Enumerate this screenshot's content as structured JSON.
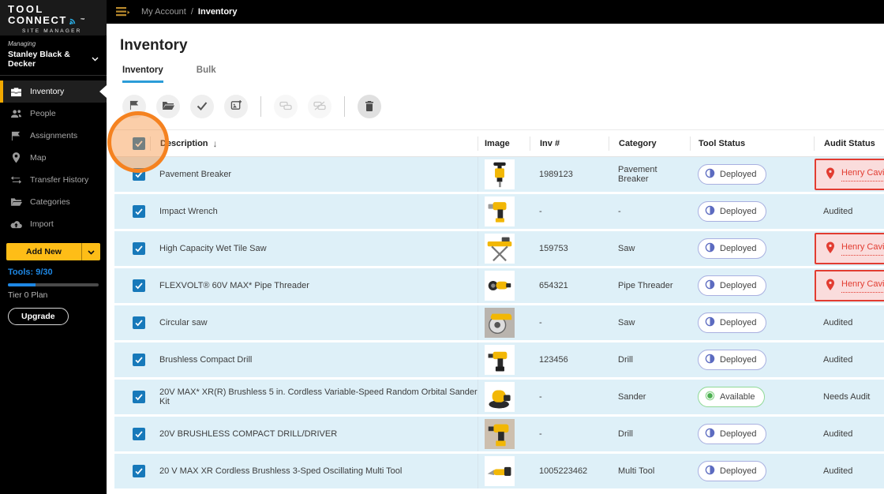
{
  "logo": {
    "line1": "TOOL",
    "line2": "CONNECT",
    "tm": "™",
    "sub": "SITE MANAGER"
  },
  "topbar": {
    "breadcrumb_parent": "My Account",
    "breadcrumb_separator": "/",
    "breadcrumb_current": "Inventory"
  },
  "sidebar": {
    "managing_label": "Managing",
    "managing_value": "Stanley Black & Decker",
    "items": [
      {
        "slug": "inventory",
        "label": "Inventory",
        "icon": "toolbox-icon",
        "active": true
      },
      {
        "slug": "people",
        "label": "People",
        "icon": "people-icon",
        "active": false
      },
      {
        "slug": "assignments",
        "label": "Assignments",
        "icon": "flag-icon",
        "active": false
      },
      {
        "slug": "map",
        "label": "Map",
        "icon": "map-pin-icon",
        "active": false
      },
      {
        "slug": "transfer-history",
        "label": "Transfer History",
        "icon": "transfer-arrows-icon",
        "active": false
      },
      {
        "slug": "categories",
        "label": "Categories",
        "icon": "folder-icon",
        "active": false
      },
      {
        "slug": "import",
        "label": "Import",
        "icon": "cloud-upload-icon",
        "active": false
      }
    ],
    "add_new_label": "Add New",
    "tools_text": "Tools: 9/30",
    "tools_used": 9,
    "tools_total": 30,
    "plan_label": "Tier 0 Plan",
    "upgrade_label": "Upgrade"
  },
  "main": {
    "title": "Inventory",
    "tabs": [
      {
        "label": "Inventory",
        "active": true
      },
      {
        "label": "Bulk",
        "active": false
      }
    ],
    "toolbar": [
      {
        "name": "flag",
        "enabled": true
      },
      {
        "name": "folder",
        "enabled": true
      },
      {
        "name": "approve",
        "enabled": true
      },
      {
        "name": "add-image",
        "enabled": true
      },
      {
        "type": "divider"
      },
      {
        "name": "transfer",
        "enabled": false
      },
      {
        "name": "transfer-cancel",
        "enabled": false
      },
      {
        "type": "divider"
      },
      {
        "name": "delete",
        "enabled": true,
        "dark": true
      }
    ]
  },
  "table": {
    "columns": [
      "Description",
      "Image",
      "Inv #",
      "Category",
      "Tool Status",
      "Audit Status"
    ],
    "sort_column": "Description",
    "sort_direction": "↓",
    "select_all_checked": true,
    "rows": [
      {
        "description": "Pavement Breaker",
        "thumb": "breaker",
        "inv": "1989123",
        "category": "Pavement Breaker",
        "tool_status": "Deployed",
        "audit_status": "Henry Cavill",
        "audit_type": "flagged",
        "checked": true
      },
      {
        "description": "Impact Wrench",
        "thumb": "impact-wrench",
        "inv": "-",
        "category": "-",
        "tool_status": "Deployed",
        "audit_status": "Audited",
        "audit_type": "plain",
        "checked": true
      },
      {
        "description": "High Capacity Wet Tile Saw",
        "thumb": "tile-saw",
        "inv": "159753",
        "category": "Saw",
        "tool_status": "Deployed",
        "audit_status": "Henry Cavill",
        "audit_type": "flagged",
        "checked": true
      },
      {
        "description": "FLEXVOLT® 60V MAX* Pipe Threader",
        "thumb": "pipe-threader",
        "inv": "654321",
        "category": "Pipe Threader",
        "tool_status": "Deployed",
        "audit_status": "Henry Cavill",
        "audit_type": "flagged",
        "checked": true
      },
      {
        "description": "Circular saw",
        "thumb": "circular-saw",
        "inv": "-",
        "category": "Saw",
        "tool_status": "Deployed",
        "audit_status": "Audited",
        "audit_type": "plain",
        "checked": true
      },
      {
        "description": "Brushless Compact Drill",
        "thumb": "drill",
        "inv": "123456",
        "category": "Drill",
        "tool_status": "Deployed",
        "audit_status": "Audited",
        "audit_type": "plain",
        "checked": true
      },
      {
        "description": "20V MAX* XR(R) Brushless 5 in. Cordless Variable-Speed Random Orbital Sander Kit",
        "thumb": "sander",
        "inv": "-",
        "category": "Sander",
        "tool_status": "Available",
        "audit_status": "Needs Audit",
        "audit_type": "plain",
        "checked": true
      },
      {
        "description": "20V BRUSHLESS COMPACT DRILL/DRIVER",
        "thumb": "drill2",
        "inv": "-",
        "category": "Drill",
        "tool_status": "Deployed",
        "audit_status": "Audited",
        "audit_type": "plain",
        "checked": true
      },
      {
        "description": "20 V MAX XR Cordless Brushless 3-Sped Oscillating Multi Tool",
        "thumb": "multi-tool",
        "inv": "1005223462",
        "category": "Multi Tool",
        "tool_status": "Deployed",
        "audit_status": "Audited",
        "audit_type": "plain",
        "checked": true
      }
    ]
  },
  "colors": {
    "brand_yellow": "#FEBD17",
    "gold_accent": "#F2A900",
    "checkbox_blue": "#1779BA",
    "tab_underline_blue": "#2B9CD8",
    "link_blue": "#1E88E5",
    "row_selected_bg": "#DEF0F8",
    "deployed_border": "#A9B0E0",
    "deployed_icon": "#5C6BC0",
    "available_border": "#8FD996",
    "available_icon": "#4CAF50",
    "audit_red": "#E23C31",
    "audit_bg": "#FADCDC",
    "highlight_orange": "#F58220"
  }
}
